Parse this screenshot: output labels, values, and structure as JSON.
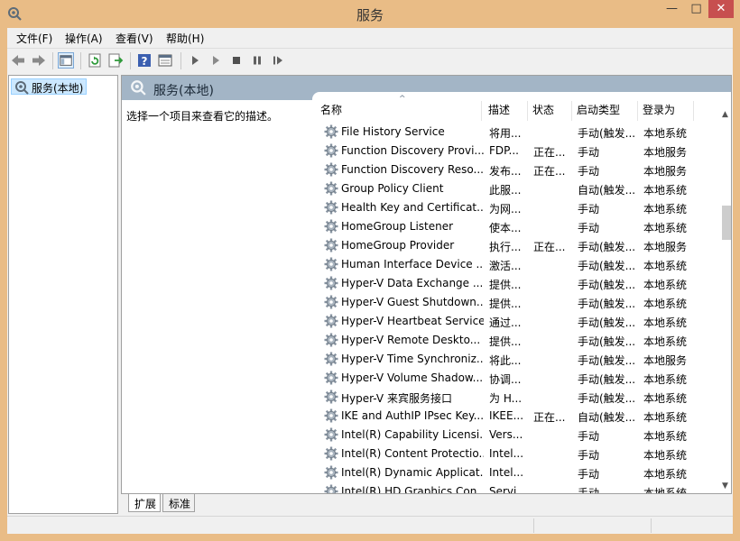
{
  "window": {
    "title": "服务",
    "minimize_glyph": "—",
    "maximize_glyph": "□",
    "close_glyph": "✕"
  },
  "menu": [
    "文件(F)",
    "操作(A)",
    "查看(V)",
    "帮助(H)"
  ],
  "toolbar": {
    "icons": [
      "back-arrow-icon",
      "forward-arrow-icon",
      "show-hide-console-tree-icon",
      "refresh-icon",
      "export-list-icon",
      "help-icon",
      "properties-icon",
      "start-service-icon",
      "start-service-alt-icon",
      "stop-service-icon",
      "pause-service-icon",
      "restart-service-icon"
    ]
  },
  "tree": {
    "item": "服务(本地)"
  },
  "header": {
    "title": "服务(本地)"
  },
  "description": "选择一个项目来查看它的描述。",
  "columns": [
    "名称",
    "描述",
    "状态",
    "启动类型",
    "登录为"
  ],
  "sort_indicator": "^",
  "rows": [
    {
      "name": "File History Service",
      "desc": "将用...",
      "status": "",
      "start": "手动(触发...",
      "logon": "本地系统"
    },
    {
      "name": "Function Discovery Provi...",
      "desc": "FDP...",
      "status": "正在...",
      "start": "手动",
      "logon": "本地服务"
    },
    {
      "name": "Function Discovery Reso...",
      "desc": "发布...",
      "status": "正在...",
      "start": "手动",
      "logon": "本地服务"
    },
    {
      "name": "Group Policy Client",
      "desc": "此服...",
      "status": "",
      "start": "自动(触发...",
      "logon": "本地系统"
    },
    {
      "name": "Health Key and Certificat...",
      "desc": "为网...",
      "status": "",
      "start": "手动",
      "logon": "本地系统"
    },
    {
      "name": "HomeGroup Listener",
      "desc": "使本...",
      "status": "",
      "start": "手动",
      "logon": "本地系统"
    },
    {
      "name": "HomeGroup Provider",
      "desc": "执行...",
      "status": "正在...",
      "start": "手动(触发...",
      "logon": "本地服务"
    },
    {
      "name": "Human Interface Device ...",
      "desc": "激活...",
      "status": "",
      "start": "手动(触发...",
      "logon": "本地系统"
    },
    {
      "name": "Hyper-V Data Exchange ...",
      "desc": "提供...",
      "status": "",
      "start": "手动(触发...",
      "logon": "本地系统"
    },
    {
      "name": "Hyper-V Guest Shutdown...",
      "desc": "提供...",
      "status": "",
      "start": "手动(触发...",
      "logon": "本地系统"
    },
    {
      "name": "Hyper-V Heartbeat Service",
      "desc": "通过...",
      "status": "",
      "start": "手动(触发...",
      "logon": "本地系统"
    },
    {
      "name": "Hyper-V Remote Deskto...",
      "desc": "提供...",
      "status": "",
      "start": "手动(触发...",
      "logon": "本地系统"
    },
    {
      "name": "Hyper-V Time Synchroniz...",
      "desc": "将此...",
      "status": "",
      "start": "手动(触发...",
      "logon": "本地服务"
    },
    {
      "name": "Hyper-V Volume Shadow...",
      "desc": "协调...",
      "status": "",
      "start": "手动(触发...",
      "logon": "本地系统"
    },
    {
      "name": "Hyper-V 来宾服务接口",
      "desc": "为 H...",
      "status": "",
      "start": "手动(触发...",
      "logon": "本地系统"
    },
    {
      "name": "IKE and AuthIP IPsec Key...",
      "desc": "IKEE...",
      "status": "正在...",
      "start": "自动(触发...",
      "logon": "本地系统"
    },
    {
      "name": "Intel(R) Capability Licensi...",
      "desc": "Vers...",
      "status": "",
      "start": "手动",
      "logon": "本地系统"
    },
    {
      "name": "Intel(R) Content Protectio...",
      "desc": "Intel...",
      "status": "",
      "start": "手动",
      "logon": "本地系统"
    },
    {
      "name": "Intel(R) Dynamic Applicat...",
      "desc": "Intel...",
      "status": "",
      "start": "手动",
      "logon": "本地系统"
    },
    {
      "name": "Intel(R) HD Graphics Con...",
      "desc": "Servi...",
      "status": "",
      "start": "手动",
      "logon": "本地系统"
    }
  ],
  "tabs": [
    "扩展",
    "标准"
  ],
  "scrollbar": {
    "up_glyph": "▲",
    "down_glyph": "▼"
  }
}
